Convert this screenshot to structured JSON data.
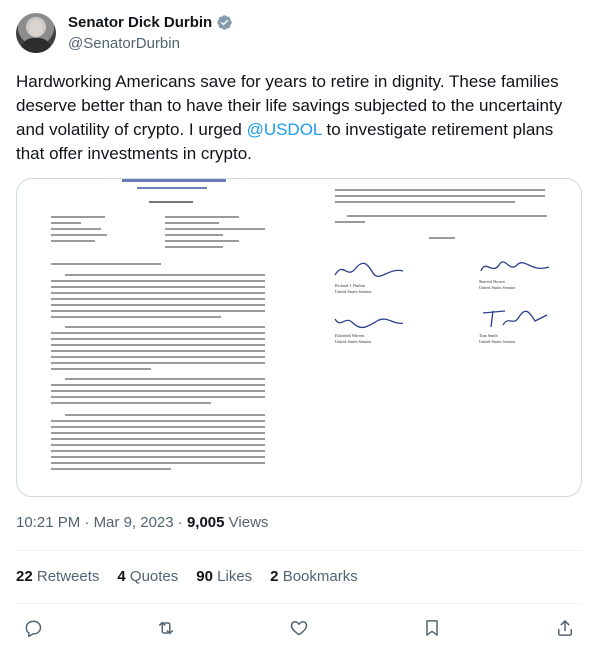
{
  "author": {
    "name": "Senator Dick Durbin",
    "handle": "@SenatorDurbin",
    "verified": true
  },
  "tweet": {
    "text_before": "Hardworking Americans save for years to retire in dignity. These families deserve better than to have their life savings subjected to the uncertainty and volatility of crypto. I urged ",
    "mention": "@USDOL",
    "text_after": " to investigate retirement plans that offer investments in crypto."
  },
  "media": {
    "type": "letter-image",
    "signatures": [
      {
        "name": "Richard J. Durbin",
        "title": "United States Senator"
      },
      {
        "name": "Sherrod Brown",
        "title": "United States Senator"
      },
      {
        "name": "Elizabeth Warren",
        "title": "United States Senator"
      },
      {
        "name": "Tina Smith",
        "title": "United States Senator"
      }
    ]
  },
  "meta": {
    "time": "10:21 PM",
    "date": "Mar 9, 2023",
    "views_count": "9,005",
    "views_label": "Views"
  },
  "stats": {
    "retweets_count": "22",
    "retweets_label": "Retweets",
    "quotes_count": "4",
    "quotes_label": "Quotes",
    "likes_count": "90",
    "likes_label": "Likes",
    "bookmarks_count": "2",
    "bookmarks_label": "Bookmarks"
  },
  "colors": {
    "accent": "#1d9bf0",
    "text": "#0f1419",
    "secondary": "#536471",
    "border": "#cfd9de"
  }
}
